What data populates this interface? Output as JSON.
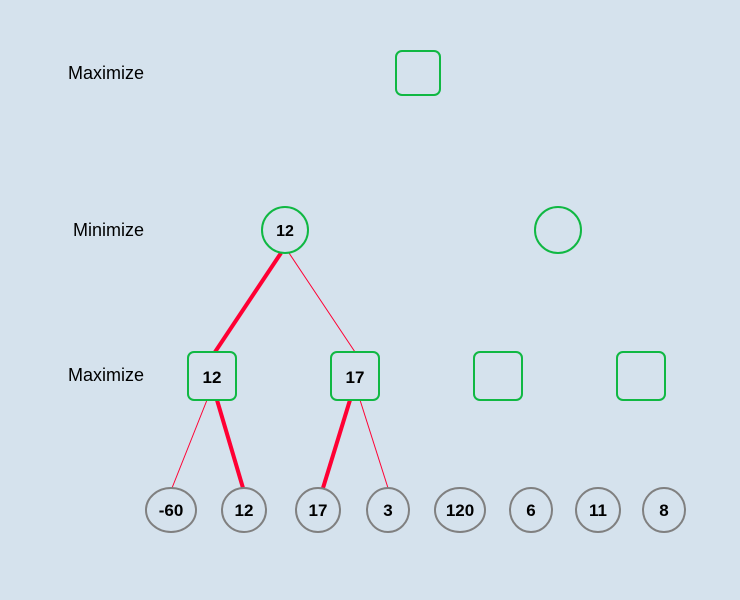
{
  "labels": {
    "l0": "Maximize",
    "l1": "Minimize",
    "l2": "Maximize"
  },
  "nodes": {
    "root": {
      "value": ""
    },
    "min_left": {
      "value": "12"
    },
    "min_right": {
      "value": ""
    },
    "max_a": {
      "value": "12"
    },
    "max_b": {
      "value": "17"
    },
    "max_c": {
      "value": ""
    },
    "max_d": {
      "value": ""
    },
    "leaves": [
      "-60",
      "12",
      "17",
      "3",
      "120",
      "6",
      "11",
      "8"
    ]
  },
  "edges": [
    {
      "from": "min_left",
      "to": "max_a",
      "chosen": true
    },
    {
      "from": "min_left",
      "to": "max_b",
      "chosen": false
    },
    {
      "from": "max_a",
      "to": "leaf0",
      "chosen": false
    },
    {
      "from": "max_a",
      "to": "leaf1",
      "chosen": true
    },
    {
      "from": "max_b",
      "to": "leaf2",
      "chosen": true
    },
    {
      "from": "max_b",
      "to": "leaf3",
      "chosen": false
    }
  ]
}
